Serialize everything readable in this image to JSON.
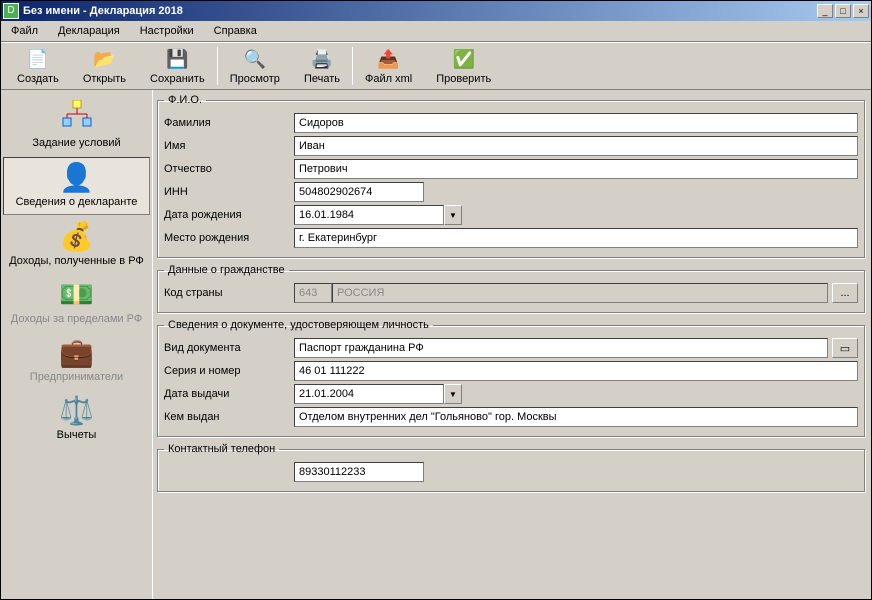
{
  "window": {
    "title": "Без имени - Декларация 2018"
  },
  "menu": {
    "file": "Файл",
    "declaration": "Декларация",
    "settings": "Настройки",
    "help": "Справка"
  },
  "toolbar": {
    "create": "Создать",
    "open": "Открыть",
    "save": "Сохранить",
    "preview": "Просмотр",
    "print": "Печать",
    "filexml": "Файл xml",
    "check": "Проверить"
  },
  "sidebar": {
    "conditions": "Задание условий",
    "declarant": "Сведения о декларанте",
    "income_rf": "Доходы, полученные в РФ",
    "income_abroad": "Доходы за пределами РФ",
    "entrepreneurs": "Предприниматели",
    "deductions": "Вычеты"
  },
  "fio": {
    "legend": "Ф.И.О.",
    "surname_label": "Фамилия",
    "surname": "Сидоров",
    "name_label": "Имя",
    "name": "Иван",
    "patronymic_label": "Отчество",
    "patronymic": "Петрович",
    "inn_label": "ИНН",
    "inn": "504802902674",
    "dob_label": "Дата рождения",
    "dob": "16.01.1984",
    "birthplace_label": "Место рождения",
    "birthplace": "г. Екатеринбург"
  },
  "citizenship": {
    "legend": "Данные о гражданстве",
    "country_code_label": "Код страны",
    "country_code": "643",
    "country_name": "РОССИЯ",
    "browse": "..."
  },
  "iddoc": {
    "legend": "Сведения о документе, удостоверяющем личность",
    "type_label": "Вид документа",
    "type": "Паспорт гражданина РФ",
    "series_label": "Серия и номер",
    "series": "46 01 111222",
    "issue_date_label": "Дата выдачи",
    "issue_date": "21.01.2004",
    "issued_by_label": "Кем выдан",
    "issued_by": "Отделом внутренних дел \"Гольяново\" гор. Москвы"
  },
  "contact": {
    "legend": "Контактный телефон",
    "phone": "89330112233"
  }
}
